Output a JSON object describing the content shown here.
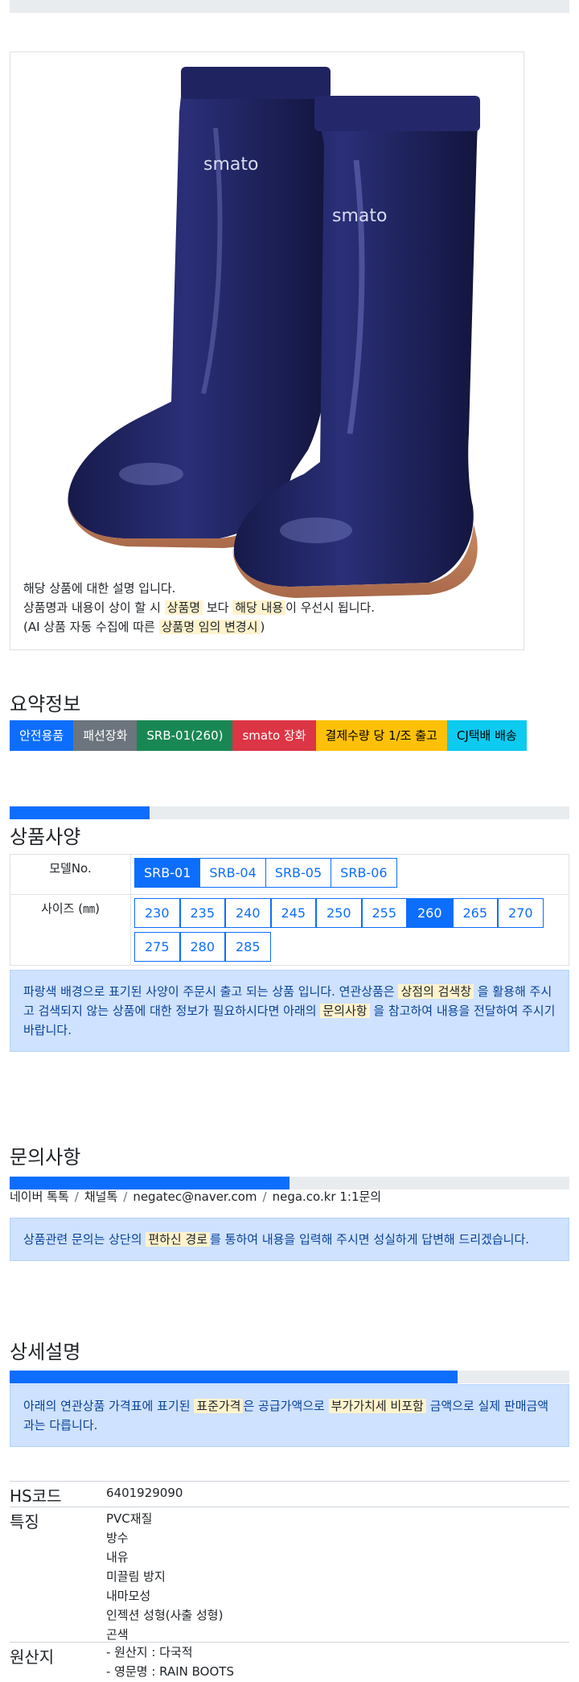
{
  "image": {
    "alt": "navy PVC rain boots",
    "brand_text": "smato",
    "description_lines": [
      {
        "parts": [
          {
            "t": "해당 상품에 대한 설명 입니다.",
            "hl": false
          }
        ]
      },
      {
        "parts": [
          {
            "t": "상품명과 내용이 상이 할 시 ",
            "hl": false
          },
          {
            "t": "상품명",
            "hl": true
          },
          {
            "t": " 보다 ",
            "hl": false
          },
          {
            "t": "해당 내용",
            "hl": true
          },
          {
            "t": "이 우선시 됩니다.",
            "hl": false
          }
        ]
      },
      {
        "parts": [
          {
            "t": "(AI 상품 자동 수집에 따른 ",
            "hl": false
          },
          {
            "t": "상품명 임의 변경시",
            "hl": true
          },
          {
            "t": ")",
            "hl": false
          }
        ]
      }
    ]
  },
  "summary": {
    "title": "요약정보",
    "badges": [
      {
        "label": "안전용품",
        "bg": "#0d6efd",
        "fg": "#ffffff"
      },
      {
        "label": "패션장화",
        "bg": "#6c757d",
        "fg": "#ffffff"
      },
      {
        "label": "SRB-01(260)",
        "bg": "#198754",
        "fg": "#ffffff"
      },
      {
        "label": "smato 장화",
        "bg": "#dc3545",
        "fg": "#ffffff"
      },
      {
        "label": "결제수량 당 1/조 출고",
        "bg": "#ffc107",
        "fg": "#000000"
      },
      {
        "label": "CJ택배 배송",
        "bg": "#0dcaf0",
        "fg": "#000000"
      }
    ]
  },
  "spec": {
    "progress_pct": 25,
    "title": "상품사양",
    "model_label": "모델No.",
    "models": [
      "SRB-01",
      "SRB-04",
      "SRB-05",
      "SRB-06"
    ],
    "selected_model": "SRB-01",
    "size_label": "사이즈 (㎜)",
    "sizes": [
      "230",
      "235",
      "240",
      "245",
      "250",
      "255",
      "260",
      "265",
      "270",
      "275",
      "280",
      "285"
    ],
    "selected_size": "260",
    "notice": [
      {
        "t": "파랑색 배경으로 표기된 사양이 주문시 출고 되는 상품 입니다. 연관상품은 ",
        "hl": false
      },
      {
        "t": "상점의 검색창",
        "hl": true
      },
      {
        "t": " 을 활용해 주시고 검색되지 않는 상품에 대한 정보가 필요하시다면 아래의 ",
        "hl": false
      },
      {
        "t": "문의사항",
        "hl": true
      },
      {
        "t": " 을 참고하여 내용을 전달하여 주시기 바랍니다.",
        "hl": false
      }
    ]
  },
  "inquiry": {
    "title": "문의사항",
    "progress_pct": 50,
    "contacts": [
      "네이버 톡톡",
      "채널톡",
      "negatec@naver.com",
      "nega.co.kr 1:1문의"
    ],
    "notice": [
      {
        "t": "상품관련 문의는 상단의 ",
        "hl": false
      },
      {
        "t": "편하신 경로",
        "hl": true
      },
      {
        "t": "를 통하여 내용을 입력해 주시면 성실하게 답변해 드리겠습니다.",
        "hl": false
      }
    ]
  },
  "detail": {
    "title": "상세설명",
    "progress_pct": 80,
    "notice": [
      {
        "t": "아래의 연관상품 가격표에 표기된 ",
        "hl": false
      },
      {
        "t": "표준가격",
        "hl": true
      },
      {
        "t": "은 공급가액으로 ",
        "hl": false
      },
      {
        "t": "부가가치세 비포함",
        "hl": true
      },
      {
        "t": " 금액으로 실제 판매금액과는 다릅니다.",
        "hl": false
      }
    ],
    "hs_label": "HS코드",
    "hs_code": "6401929090",
    "feature_label": "특징",
    "features": [
      "PVC재질",
      "방수",
      "내유",
      "미끌림 방지",
      "내마모성",
      "인젝션 성형(사출 성형)",
      "곤색"
    ],
    "origin_label": "원산지",
    "origin": [
      "- 원산지 : 다국적",
      "- 영문명 : RAIN BOOTS"
    ]
  }
}
